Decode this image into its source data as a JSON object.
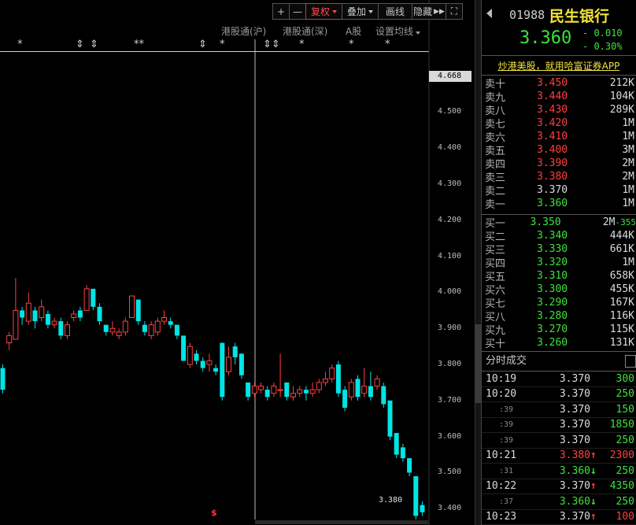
{
  "toolbar": {
    "zoom_in": "+",
    "zoom_out": "—",
    "fuquan": "复权",
    "overlay": "叠加",
    "draw": "画线",
    "hide": "隐藏",
    "fullscreen": "⛶"
  },
  "sub_toolbar": {
    "hk_sh": "港股通(沪)",
    "hk_sz": "港股通(深)",
    "a_share": "A股",
    "ma_settings": "设置均线"
  },
  "chart_data": {
    "type": "candlestick",
    "ylim": [
      3.37,
      4.68
    ],
    "y_ticks": [
      "4.600",
      "4.500",
      "4.400",
      "4.300",
      "4.200",
      "4.100",
      "4.000",
      "3.900",
      "3.800",
      "3.700",
      "3.600",
      "3.500",
      "3.400"
    ],
    "current_price_label": "4.668",
    "low_label": "3.380",
    "marker_label": "$",
    "markers": [
      "*",
      "⇕",
      "⇕",
      "**",
      "⇕",
      "*",
      "⇕⇕",
      "*",
      "*",
      "*"
    ],
    "candles": [
      {
        "o": 3.79,
        "c": 3.73,
        "h": 3.8,
        "l": 3.72
      },
      {
        "o": 3.86,
        "c": 3.88,
        "h": 3.89,
        "l": 3.84
      },
      {
        "o": 3.87,
        "c": 3.95,
        "h": 4.04,
        "l": 3.87
      },
      {
        "o": 3.95,
        "c": 3.93,
        "h": 3.96,
        "l": 3.91
      },
      {
        "o": 3.92,
        "c": 3.97,
        "h": 4.0,
        "l": 3.91
      },
      {
        "o": 3.95,
        "c": 3.92,
        "h": 3.96,
        "l": 3.9
      },
      {
        "o": 3.93,
        "c": 3.96,
        "h": 3.98,
        "l": 3.92
      },
      {
        "o": 3.94,
        "c": 3.91,
        "h": 3.95,
        "l": 3.9
      },
      {
        "o": 3.91,
        "c": 3.92,
        "h": 3.93,
        "l": 3.9
      },
      {
        "o": 3.92,
        "c": 3.88,
        "h": 3.93,
        "l": 3.87
      },
      {
        "o": 3.88,
        "c": 3.91,
        "h": 3.92,
        "l": 3.87
      },
      {
        "o": 3.93,
        "c": 3.94,
        "h": 3.95,
        "l": 3.92
      },
      {
        "o": 3.95,
        "c": 3.93,
        "h": 3.96,
        "l": 3.92
      },
      {
        "o": 3.95,
        "c": 4.01,
        "h": 4.02,
        "l": 3.95
      },
      {
        "o": 4.01,
        "c": 3.96,
        "h": 4.01,
        "l": 3.95
      },
      {
        "o": 3.96,
        "c": 3.92,
        "h": 3.97,
        "l": 3.91
      },
      {
        "o": 3.91,
        "c": 3.89,
        "h": 3.91,
        "l": 3.88
      },
      {
        "o": 3.89,
        "c": 3.9,
        "h": 3.92,
        "l": 3.88
      },
      {
        "o": 3.88,
        "c": 3.89,
        "h": 3.9,
        "l": 3.87
      },
      {
        "o": 3.89,
        "c": 3.92,
        "h": 3.93,
        "l": 3.88
      },
      {
        "o": 3.93,
        "c": 3.99,
        "h": 3.99,
        "l": 3.93
      },
      {
        "o": 3.98,
        "c": 3.92,
        "h": 3.98,
        "l": 3.91
      },
      {
        "o": 3.91,
        "c": 3.89,
        "h": 3.92,
        "l": 3.88
      },
      {
        "o": 3.88,
        "c": 3.91,
        "h": 3.92,
        "l": 3.87
      },
      {
        "o": 3.89,
        "c": 3.92,
        "h": 3.93,
        "l": 3.88
      },
      {
        "o": 3.92,
        "c": 3.93,
        "h": 3.95,
        "l": 3.91
      },
      {
        "o": 3.92,
        "c": 3.91,
        "h": 3.93,
        "l": 3.9
      },
      {
        "o": 3.91,
        "c": 3.88,
        "h": 3.91,
        "l": 3.87
      },
      {
        "o": 3.88,
        "c": 3.81,
        "h": 3.88,
        "l": 3.81
      },
      {
        "o": 3.8,
        "c": 3.85,
        "h": 3.86,
        "l": 3.79
      },
      {
        "o": 3.83,
        "c": 3.81,
        "h": 3.84,
        "l": 3.8
      },
      {
        "o": 3.81,
        "c": 3.79,
        "h": 3.82,
        "l": 3.78
      },
      {
        "o": 3.8,
        "c": 3.81,
        "h": 3.83,
        "l": 3.78
      },
      {
        "o": 3.79,
        "c": 3.78,
        "h": 3.8,
        "l": 3.77
      },
      {
        "o": 3.86,
        "c": 3.71,
        "h": 3.86,
        "l": 3.7
      },
      {
        "o": 3.78,
        "c": 3.82,
        "h": 3.85,
        "l": 3.77
      },
      {
        "o": 3.85,
        "c": 3.82,
        "h": 3.86,
        "l": 3.8
      },
      {
        "o": 3.83,
        "c": 3.77,
        "h": 3.83,
        "l": 3.76
      },
      {
        "o": 3.75,
        "c": 3.71,
        "h": 3.75,
        "l": 3.7
      },
      {
        "o": 3.72,
        "c": 3.74,
        "h": 3.75,
        "l": 3.71
      },
      {
        "o": 3.73,
        "c": 3.74,
        "h": 3.75,
        "l": 3.72
      },
      {
        "o": 3.73,
        "c": 3.71,
        "h": 3.74,
        "l": 3.7
      },
      {
        "o": 3.72,
        "c": 3.74,
        "h": 3.75,
        "l": 3.71
      },
      {
        "o": 3.73,
        "c": 3.73,
        "h": 3.83,
        "l": 3.71
      },
      {
        "o": 3.75,
        "c": 3.71,
        "h": 3.75,
        "l": 3.7
      },
      {
        "o": 3.71,
        "c": 3.72,
        "h": 3.74,
        "l": 3.7
      },
      {
        "o": 3.72,
        "c": 3.73,
        "h": 3.74,
        "l": 3.71
      },
      {
        "o": 3.73,
        "c": 3.72,
        "h": 3.74,
        "l": 3.7
      },
      {
        "o": 3.72,
        "c": 3.73,
        "h": 3.75,
        "l": 3.71
      },
      {
        "o": 3.73,
        "c": 3.75,
        "h": 3.76,
        "l": 3.72
      },
      {
        "o": 3.75,
        "c": 3.76,
        "h": 3.78,
        "l": 3.74
      },
      {
        "o": 3.76,
        "c": 3.79,
        "h": 3.8,
        "l": 3.75
      },
      {
        "o": 3.8,
        "c": 3.72,
        "h": 3.81,
        "l": 3.71
      },
      {
        "o": 3.73,
        "c": 3.68,
        "h": 3.74,
        "l": 3.67
      },
      {
        "o": 3.71,
        "c": 3.75,
        "h": 3.76,
        "l": 3.7
      },
      {
        "o": 3.76,
        "c": 3.71,
        "h": 3.77,
        "l": 3.7
      },
      {
        "o": 3.72,
        "c": 3.74,
        "h": 3.79,
        "l": 3.71
      },
      {
        "o": 3.74,
        "c": 3.71,
        "h": 3.78,
        "l": 3.7
      },
      {
        "o": 3.74,
        "c": 3.76,
        "h": 3.77,
        "l": 3.73
      },
      {
        "o": 3.74,
        "c": 3.69,
        "h": 3.75,
        "l": 3.68
      },
      {
        "o": 3.7,
        "c": 3.6,
        "h": 3.7,
        "l": 3.59
      },
      {
        "o": 3.61,
        "c": 3.55,
        "h": 3.61,
        "l": 3.54
      },
      {
        "o": 3.57,
        "c": 3.54,
        "h": 3.58,
        "l": 3.53
      },
      {
        "o": 3.54,
        "c": 3.5,
        "h": 3.54,
        "l": 3.49
      },
      {
        "o": 3.49,
        "c": 3.38,
        "h": 3.49,
        "l": 3.37
      },
      {
        "o": 3.41,
        "c": 3.39,
        "h": 3.42,
        "l": 3.38
      }
    ]
  },
  "quote": {
    "code": "01988",
    "name": "民生银行",
    "last": "3.360",
    "change": "- 0.010",
    "change_pct": "- 0.30%",
    "promo": "炒港美股，就用哈富证券APP"
  },
  "asks": [
    {
      "label": "卖十",
      "price": "3.450",
      "vol": "212K",
      "dir": "up"
    },
    {
      "label": "卖九",
      "price": "3.440",
      "vol": "104K",
      "dir": "up"
    },
    {
      "label": "卖八",
      "price": "3.430",
      "vol": "289K",
      "dir": "up"
    },
    {
      "label": "卖七",
      "price": "3.420",
      "vol": "1M",
      "dir": "up"
    },
    {
      "label": "卖六",
      "price": "3.410",
      "vol": "1M",
      "dir": "up"
    },
    {
      "label": "卖五",
      "price": "3.400",
      "vol": "3M",
      "dir": "up"
    },
    {
      "label": "卖四",
      "price": "3.390",
      "vol": "2M",
      "dir": "up"
    },
    {
      "label": "卖三",
      "price": "3.380",
      "vol": "2M",
      "dir": "up"
    },
    {
      "label": "卖二",
      "price": "3.370",
      "vol": "1M",
      "dir": "eq"
    },
    {
      "label": "卖一",
      "price": "3.360",
      "vol": "1M",
      "dir": "dn"
    }
  ],
  "bids": [
    {
      "label": "买一",
      "price": "3.350",
      "vol": "2M",
      "extra": "-355",
      "dir": "dn"
    },
    {
      "label": "买二",
      "price": "3.340",
      "vol": "444K",
      "dir": "dn"
    },
    {
      "label": "买三",
      "price": "3.330",
      "vol": "661K",
      "dir": "dn"
    },
    {
      "label": "买四",
      "price": "3.320",
      "vol": "1M",
      "dir": "dn"
    },
    {
      "label": "买五",
      "price": "3.310",
      "vol": "658K",
      "dir": "dn"
    },
    {
      "label": "买六",
      "price": "3.300",
      "vol": "455K",
      "dir": "dn"
    },
    {
      "label": "买七",
      "price": "3.290",
      "vol": "167K",
      "dir": "dn"
    },
    {
      "label": "买八",
      "price": "3.280",
      "vol": "116K",
      "dir": "dn"
    },
    {
      "label": "买九",
      "price": "3.270",
      "vol": "115K",
      "dir": "dn"
    },
    {
      "label": "买十",
      "price": "3.260",
      "vol": "131K",
      "dir": "dn"
    }
  ],
  "trades_title": "分时成交",
  "trades": [
    {
      "time": "10:19",
      "price": "3.370",
      "arrow": "",
      "vol": "300",
      "dir": "eq",
      "vdir": "dn",
      "sub": false
    },
    {
      "time": "10:20",
      "price": "3.370",
      "arrow": "",
      "vol": "250",
      "dir": "eq",
      "vdir": "dn",
      "sub": false
    },
    {
      "time": ":39",
      "price": "3.370",
      "arrow": "",
      "vol": "150",
      "dir": "eq",
      "vdir": "dn",
      "sub": true
    },
    {
      "time": ":39",
      "price": "3.370",
      "arrow": "",
      "vol": "1850",
      "dir": "eq",
      "vdir": "dn",
      "sub": true
    },
    {
      "time": ":39",
      "price": "3.370",
      "arrow": "",
      "vol": "250",
      "dir": "eq",
      "vdir": "dn",
      "sub": true
    },
    {
      "time": "10:21",
      "price": "3.380",
      "arrow": "↑",
      "vol": "2300",
      "dir": "up",
      "vdir": "up",
      "sub": false
    },
    {
      "time": ":31",
      "price": "3.360",
      "arrow": "↓",
      "vol": "250",
      "dir": "dn",
      "vdir": "dn",
      "sub": true
    },
    {
      "time": "10:22",
      "price": "3.370",
      "arrow": "↑",
      "vol": "4350",
      "dir": "eq",
      "vdir": "dn",
      "sub": false
    },
    {
      "time": ":37",
      "price": "3.360",
      "arrow": "↓",
      "vol": "250",
      "dir": "dn",
      "vdir": "dn",
      "sub": true
    },
    {
      "time": "10:23",
      "price": "3.370",
      "arrow": "↑",
      "vol": "100",
      "dir": "eq",
      "vdir": "up",
      "sub": false
    },
    {
      "time": ":43",
      "price": "3.360",
      "arrow": "↓",
      "vol": "1500",
      "dir": "dn",
      "vdir": "dn",
      "sub": true
    }
  ],
  "colors": {
    "up": "#ff4040",
    "down": "#00e5e5",
    "text_green": "#3ee23e",
    "name": "#f0e23a"
  }
}
